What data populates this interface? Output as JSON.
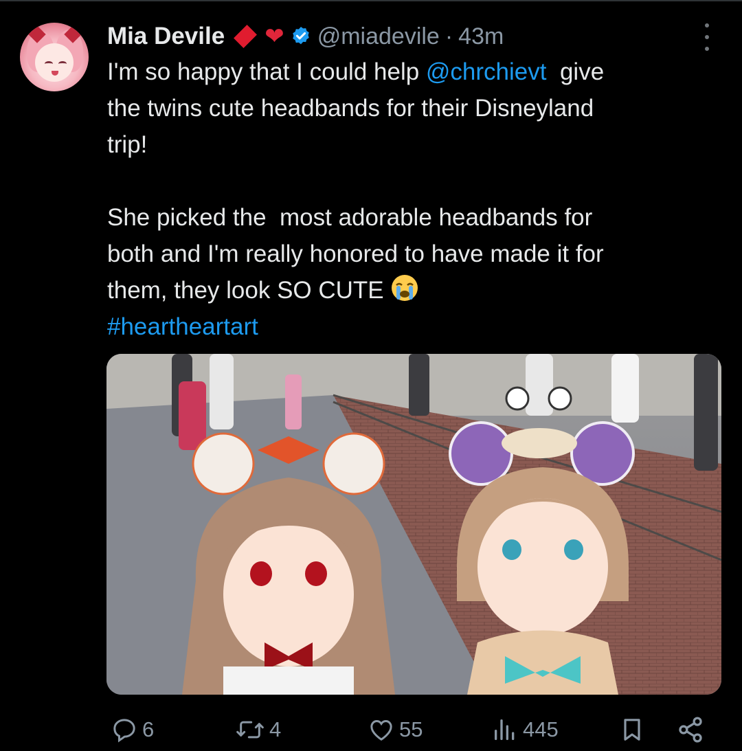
{
  "author": {
    "name": "Mia Devile",
    "handle": "@miadevile",
    "separator": "·",
    "time": "43m",
    "verified": true
  },
  "tweet": {
    "line1_pre": "I'm so happy that I could help ",
    "mention": "@chrchievt",
    "line1_post": "  give",
    "line2": "the twins cute headbands for their Disneyland",
    "line3": "trip!",
    "line4": "She picked the  most adorable headbands for",
    "line5": "both and I'm really honored to have made it for",
    "line6": "them, they look SO CUTE ",
    "hashtag": "#heartheartart"
  },
  "icons": {
    "more": "more-vertical-icon",
    "reply": "reply-icon",
    "retweet": "retweet-icon",
    "like": "like-icon",
    "views": "views-icon",
    "bookmark": "bookmark-icon",
    "share": "share-icon",
    "emoji": "loudly-crying-face-emoji"
  },
  "stats": {
    "replies": "6",
    "retweets": "4",
    "likes": "55",
    "views": "445"
  },
  "colors": {
    "link": "#1d9bf0",
    "text": "#e7e9ea",
    "muted": "#8b98a5",
    "background": "#000000"
  }
}
